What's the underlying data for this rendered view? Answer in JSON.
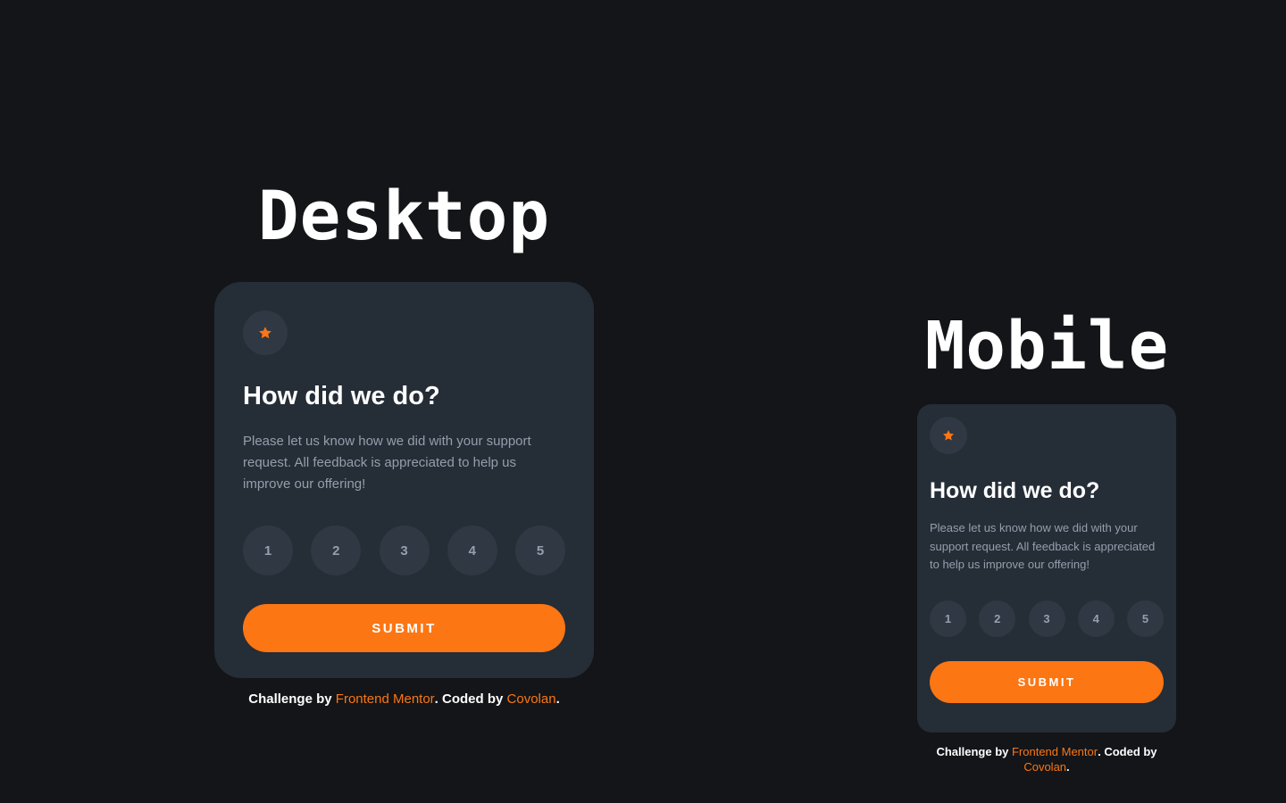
{
  "labels": {
    "desktop": "Desktop",
    "mobile": "Mobile"
  },
  "card": {
    "icon": "star-icon",
    "title": "How did we do?",
    "description": "Please let us know how we did with your support request. All feedback is appreciated to help us improve our offering!",
    "ratings": [
      "1",
      "2",
      "3",
      "4",
      "5"
    ],
    "submit_label": "SUBMIT"
  },
  "attribution": {
    "prefix": "Challenge by ",
    "mentor_link": "Frontend Mentor",
    "middle": ". Coded by ",
    "author_link": "Covolan",
    "suffix": "."
  },
  "colors": {
    "background": "#131518",
    "card": "#252d37",
    "accent": "#fc7614",
    "muted_text": "#959eac",
    "circle": "#2f3843"
  }
}
